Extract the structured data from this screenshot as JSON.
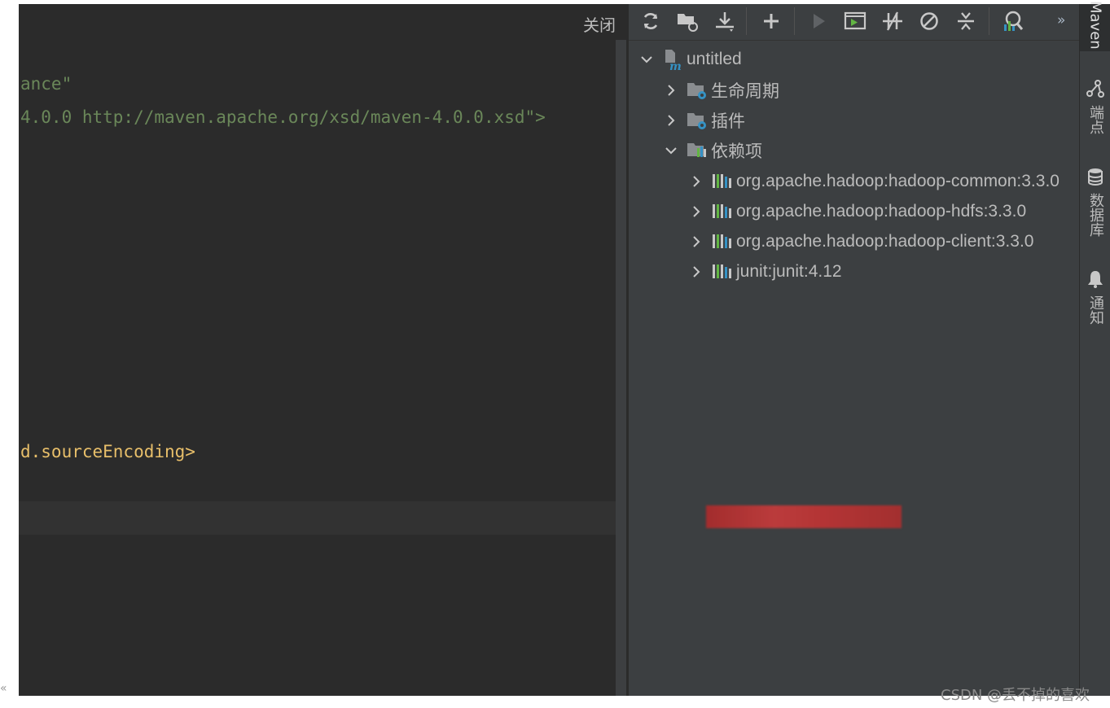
{
  "editor": {
    "close_label": "关闭",
    "lines": [
      {
        "text": "ance\"",
        "color": "#6a8759"
      },
      {
        "text": "4.0.0 http://maven.apache.org/xsd/maven-4.0.0.xsd\">",
        "color": "#6a8759"
      },
      {
        "text": "d.sourceEncoding>",
        "color": "#e8bf6a"
      }
    ]
  },
  "maven": {
    "toolbar": [
      {
        "name": "reload-icon",
        "title": "Reload"
      },
      {
        "name": "generate-sources-icon",
        "title": "Generate Sources"
      },
      {
        "name": "download-icon",
        "title": "Download"
      },
      {
        "name": "add-icon",
        "title": "Add"
      },
      {
        "name": "run-icon",
        "title": "Run"
      },
      {
        "name": "execute-goal-icon",
        "title": "Execute Goal"
      },
      {
        "name": "toggle-offline-icon",
        "title": "Toggle Offline"
      },
      {
        "name": "skip-tests-icon",
        "title": "Skip Tests"
      },
      {
        "name": "collapse-all-icon",
        "title": "Collapse All"
      },
      {
        "name": "analyze-dependencies-icon",
        "title": "Analyze Dependencies"
      }
    ],
    "more_label": "»",
    "tree": {
      "root": "untitled",
      "lifecycle": "生命周期",
      "plugins": "插件",
      "dependencies": "依赖项",
      "deps": [
        "org.apache.hadoop:hadoop-common:3.3.0",
        "org.apache.hadoop:hadoop-hdfs:3.3.0",
        "org.apache.hadoop:hadoop-client:3.3.0",
        "junit:junit:4.12"
      ]
    }
  },
  "sidebar": {
    "maven": "Maven",
    "endpoints": "端点",
    "database": "数据库",
    "notifications": "通知"
  },
  "watermark": "CSDN @丢不掉的喜欢",
  "colors": {
    "editor_bg": "#2b2b2b",
    "panel_bg": "#3c3f41",
    "text": "#bbbbbb",
    "string_green": "#6a8759",
    "tag_orange": "#e8bf6a",
    "icon_blue": "#3592c4",
    "icon_green": "#62b543"
  }
}
